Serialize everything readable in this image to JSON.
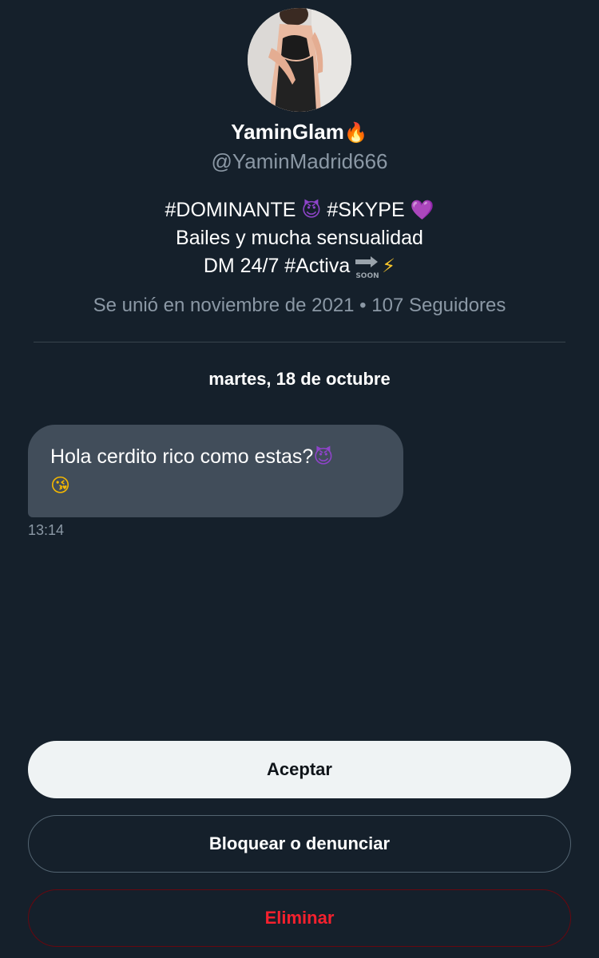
{
  "profile": {
    "display_name": "YaminGlam",
    "name_emoji": "🔥",
    "handle": "@YaminMadrid666",
    "bio": {
      "line1_tag1": "#DOMINANTE",
      "line1_emoji1": "😈",
      "line1_tag2": "#SKYPE",
      "line1_emoji2": "💜",
      "line2": "Bailes y mucha sensualidad",
      "line3_text": "DM 24/7 #Activa",
      "line3_soon": "SOON",
      "line3_emoji": "⚡"
    },
    "meta": "Se unió en noviembre de 2021 • 107 Seguidores"
  },
  "conversation": {
    "date_label": "martes, 18 de octubre",
    "messages": [
      {
        "text": "Hola cerdito rico como estas?",
        "emoji1": "😈",
        "emoji2": "😘",
        "time": "13:14"
      }
    ]
  },
  "actions": {
    "accept_label": "Aceptar",
    "block_label": "Bloquear o denunciar",
    "delete_label": "Eliminar"
  },
  "colors": {
    "background": "#15202b",
    "secondary_text": "#8b98a5",
    "bubble": "#414d5a",
    "accept_bg": "#eff3f4",
    "delete_text": "#f4212e"
  }
}
